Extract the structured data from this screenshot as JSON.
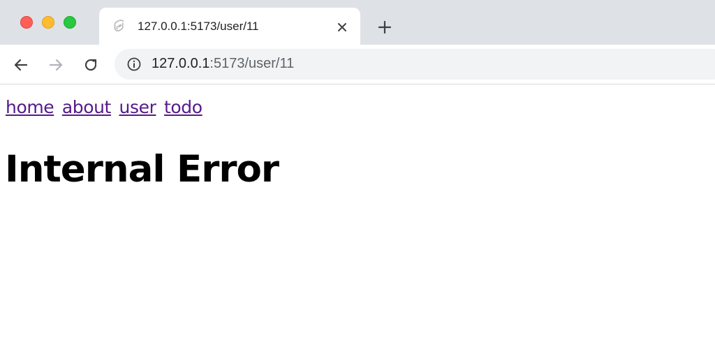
{
  "browser": {
    "tab": {
      "title": "127.0.0.1:5173/user/11"
    },
    "address": {
      "host": "127.0.0.1",
      "rest": ":5173/user/11"
    }
  },
  "icons": {
    "tab_favicon": "svelte-icon",
    "tab_close": "close-icon",
    "new_tab": "plus-icon",
    "back": "arrow-left-icon",
    "forward": "arrow-right-icon",
    "reload": "reload-icon",
    "site_info": "info-icon"
  },
  "page": {
    "nav": [
      {
        "label": "home"
      },
      {
        "label": "about"
      },
      {
        "label": "user"
      },
      {
        "label": "todo"
      }
    ],
    "heading": "Internal Error"
  },
  "colors": {
    "link": "#551a8b",
    "tabbar": "#dee1e6",
    "omnibox": "#f1f3f4"
  }
}
